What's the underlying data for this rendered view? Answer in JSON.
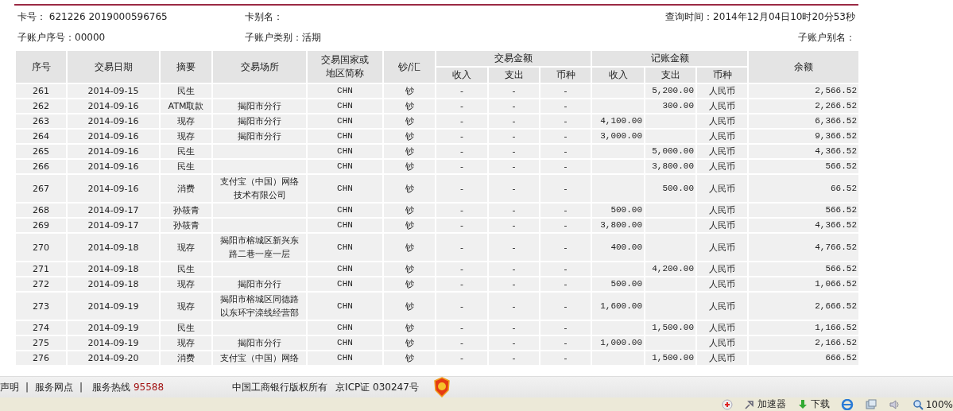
{
  "info": [
    {
      "label": "卡号：",
      "value": "621226 2019000596765"
    },
    {
      "label": "卡别名："
    },
    {
      "label": "查询时间：",
      "value": "2014年12月04日10时20分53秒"
    },
    {
      "label": "子账户序号：",
      "value": "00000"
    },
    {
      "label": "子账户类别：",
      "value": "活期"
    },
    {
      "label": "子账户别名："
    }
  ],
  "table": {
    "columns": [
      [
        "序号"
      ],
      [
        "交易日期"
      ],
      [
        "摘要"
      ],
      [
        "交易场所"
      ],
      [
        "交易国家或",
        "地区简称"
      ],
      [
        "钞/汇"
      ],
      [
        "余额"
      ]
    ],
    "groups": [
      {
        "label": "交易金额",
        "sub": [
          "收入",
          "支出",
          "币种"
        ]
      },
      {
        "label": "记账金额",
        "sub": [
          "收入",
          "支出",
          "币种"
        ]
      }
    ],
    "rows": [
      {
        "no": "261",
        "date": "2014-09-15",
        "summary": "民生",
        "place": [],
        "region": "CHN",
        "cash": "钞",
        "txn": [
          "-",
          "-",
          "-"
        ],
        "book_in": "",
        "book_out": "5,200.00",
        "currency": "人民币",
        "balance": "2,566.52"
      },
      {
        "no": "262",
        "date": "2014-09-16",
        "summary": "ATM取款",
        "place": [
          "揭阳市分行"
        ],
        "region": "CHN",
        "cash": "钞",
        "txn": [
          "-",
          "-",
          "-"
        ],
        "book_in": "",
        "book_out": "300.00",
        "currency": "人民币",
        "balance": "2,266.52"
      },
      {
        "no": "263",
        "date": "2014-09-16",
        "summary": "现存",
        "place": [
          "揭阳市分行"
        ],
        "region": "CHN",
        "cash": "钞",
        "txn": [
          "-",
          "-",
          "-"
        ],
        "book_in": "4,100.00",
        "book_out": "",
        "currency": "人民币",
        "balance": "6,366.52"
      },
      {
        "no": "264",
        "date": "2014-09-16",
        "summary": "现存",
        "place": [
          "揭阳市分行"
        ],
        "region": "CHN",
        "cash": "钞",
        "txn": [
          "-",
          "-",
          "-"
        ],
        "book_in": "3,000.00",
        "book_out": "",
        "currency": "人民币",
        "balance": "9,366.52"
      },
      {
        "no": "265",
        "date": "2014-09-16",
        "summary": "民生",
        "place": [],
        "region": "CHN",
        "cash": "钞",
        "txn": [
          "-",
          "-",
          "-"
        ],
        "book_in": "",
        "book_out": "5,000.00",
        "currency": "人民币",
        "balance": "4,366.52"
      },
      {
        "no": "266",
        "date": "2014-09-16",
        "summary": "民生",
        "place": [],
        "region": "CHN",
        "cash": "钞",
        "txn": [
          "-",
          "-",
          "-"
        ],
        "book_in": "",
        "book_out": "3,800.00",
        "currency": "人民币",
        "balance": "566.52"
      },
      {
        "no": "267",
        "date": "2014-09-16",
        "summary": "消费",
        "place": [
          "支付宝（中国）网络",
          "技术有限公司"
        ],
        "region": "CHN",
        "cash": "钞",
        "txn": [
          "-",
          "-",
          "-"
        ],
        "book_in": "",
        "book_out": "500.00",
        "currency": "人民币",
        "balance": "66.52"
      },
      {
        "no": "268",
        "date": "2014-09-17",
        "summary": "孙筱青",
        "place": [],
        "region": "CHN",
        "cash": "钞",
        "txn": [
          "-",
          "-",
          "-"
        ],
        "book_in": "500.00",
        "book_out": "",
        "currency": "人民币",
        "balance": "566.52"
      },
      {
        "no": "269",
        "date": "2014-09-17",
        "summary": "孙筱青",
        "place": [],
        "region": "CHN",
        "cash": "钞",
        "txn": [
          "-",
          "-",
          "-"
        ],
        "book_in": "3,800.00",
        "book_out": "",
        "currency": "人民币",
        "balance": "4,366.52"
      },
      {
        "no": "270",
        "date": "2014-09-18",
        "summary": "现存",
        "place": [
          "揭阳市榕城区新兴东",
          "路二巷一座一层"
        ],
        "region": "CHN",
        "cash": "钞",
        "txn": [
          "-",
          "-",
          "-"
        ],
        "book_in": "400.00",
        "book_out": "",
        "currency": "人民币",
        "balance": "4,766.52"
      },
      {
        "no": "271",
        "date": "2014-09-18",
        "summary": "民生",
        "place": [],
        "region": "CHN",
        "cash": "钞",
        "txn": [
          "-",
          "-",
          "-"
        ],
        "book_in": "",
        "book_out": "4,200.00",
        "currency": "人民币",
        "balance": "566.52"
      },
      {
        "no": "272",
        "date": "2014-09-18",
        "summary": "现存",
        "place": [
          "揭阳市分行"
        ],
        "region": "CHN",
        "cash": "钞",
        "txn": [
          "-",
          "-",
          "-"
        ],
        "book_in": "500.00",
        "book_out": "",
        "currency": "人民币",
        "balance": "1,066.52"
      },
      {
        "no": "273",
        "date": "2014-09-19",
        "summary": "现存",
        "place": [
          "揭阳市榕城区同德路",
          "以东环宇滦线经营部"
        ],
        "region": "CHN",
        "cash": "钞",
        "txn": [
          "-",
          "-",
          "-"
        ],
        "book_in": "1,600.00",
        "book_out": "",
        "currency": "人民币",
        "balance": "2,666.52"
      },
      {
        "no": "274",
        "date": "2014-09-19",
        "summary": "民生",
        "place": [],
        "region": "CHN",
        "cash": "钞",
        "txn": [
          "-",
          "-",
          "-"
        ],
        "book_in": "",
        "book_out": "1,500.00",
        "currency": "人民币",
        "balance": "1,166.52"
      },
      {
        "no": "275",
        "date": "2014-09-19",
        "summary": "现存",
        "place": [
          "揭阳市分行"
        ],
        "region": "CHN",
        "cash": "钞",
        "txn": [
          "-",
          "-",
          "-"
        ],
        "book_in": "1,000.00",
        "book_out": "",
        "currency": "人民币",
        "balance": "2,166.52"
      },
      {
        "no": "276",
        "date": "2014-09-20",
        "summary": "消费",
        "place": [
          "支付宝（中国）网络"
        ],
        "region": "CHN",
        "cash": "钞",
        "txn": [
          "-",
          "-",
          "-"
        ],
        "book_in": "",
        "book_out": "1,500.00",
        "currency": "人民币",
        "balance": "666.52"
      }
    ]
  },
  "footer": {
    "links": [
      "声明",
      "服务网点"
    ],
    "separator": "|",
    "hotline_label": "服务热线",
    "hotline": "95588",
    "copyright": "中国工商银行版权所有",
    "icp": "京ICP证 030247号"
  },
  "status_bar": {
    "items": [
      {
        "kind": "accelerator",
        "label": "加速器"
      },
      {
        "kind": "download",
        "label": "下载"
      }
    ],
    "zoom": "100%"
  }
}
